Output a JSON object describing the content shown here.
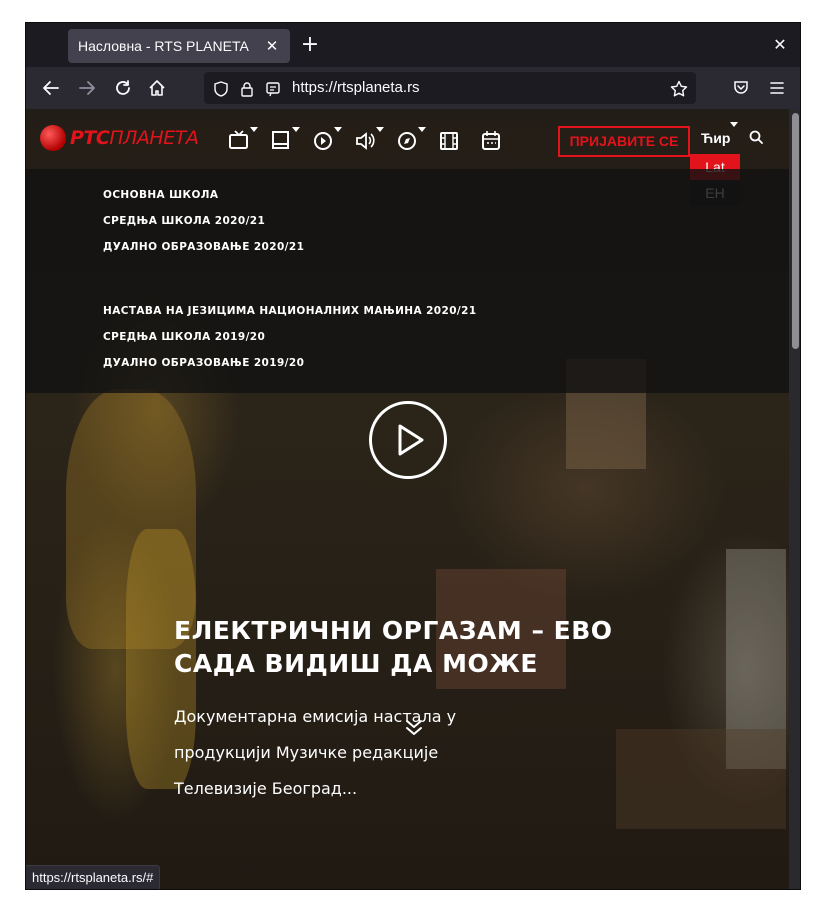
{
  "browser": {
    "tab_title": "Насловна - RTS PLANETA",
    "tab_close": "✕",
    "new_tab": "+",
    "window_close": "✕",
    "url": "https://rtsplaneta.rs",
    "status_url": "https://rtsplaneta.rs/#",
    "nav_icons": [
      "back-icon",
      "forward-icon",
      "reload-icon",
      "home-icon",
      "shield-icon",
      "lock-icon",
      "page-icon",
      "star-icon",
      "pocket-icon",
      "menu-icon"
    ]
  },
  "site": {
    "logo_bold": "РТС",
    "logo_rest": "ПЛАНЕТА",
    "category_icons": [
      "tv-icon",
      "book-icon",
      "play-circle-icon",
      "speaker-icon",
      "compass-icon",
      "film-icon",
      "calendar-icon"
    ],
    "login_label": "ПРИЈАВИТЕ СЕ",
    "language_current": "Ћир",
    "language_options": [
      "Lat",
      "EH"
    ],
    "submenu": [
      "ОСНОВНА ШКОЛА",
      "СРЕДЊА ШКОЛА 2020/21",
      "ДУАЛНО ОБРАЗОВАЊЕ 2020/21",
      "НАСТАВА НА ЈЕЗИЦИМА НАЦИОНАЛНИХ МАЊИНА 2020/21",
      "СРЕДЊА ШКОЛА 2019/20",
      "ДУАЛНО ОБРАЗОВАЊЕ 2019/20"
    ],
    "hero": {
      "title_line1": "ЕЛЕКТРИЧНИ ОРГАЗАМ – ЕВО",
      "title_line2": "САДА ВИДИШ ДА МОЖЕ",
      "desc_line1": "Документарна емисија настала у",
      "desc_line2": "продукцији Музичке редакције",
      "desc_line3": "Телевизије Београд..."
    }
  },
  "colors": {
    "accent": "#e3131b",
    "chrome_dark": "#1c1b22",
    "chrome_bar": "#2b2a33"
  }
}
